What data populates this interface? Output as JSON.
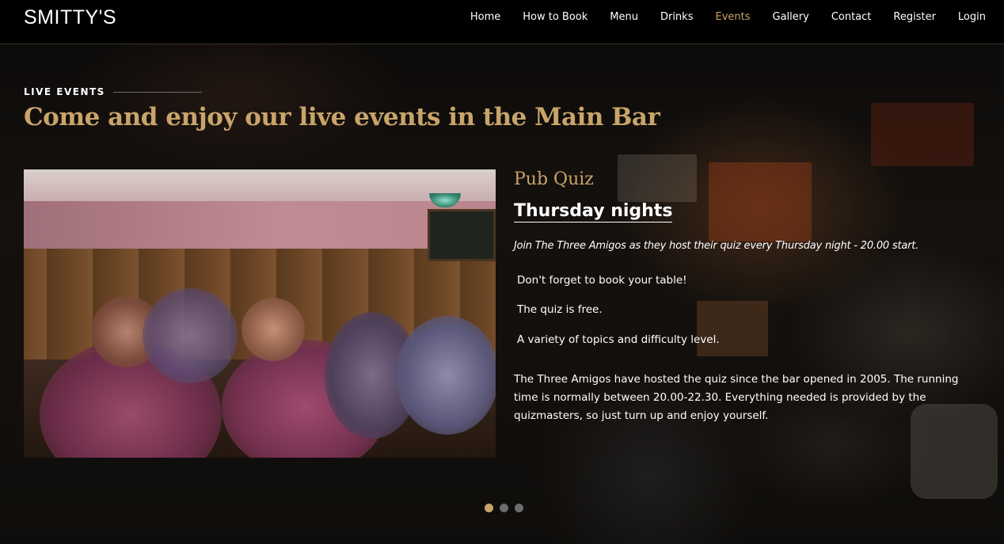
{
  "navbar": {
    "brand": "SMITTY'S",
    "items": [
      {
        "label": "Home",
        "active": false
      },
      {
        "label": "How to Book",
        "active": false
      },
      {
        "label": "Menu",
        "active": false
      },
      {
        "label": "Drinks",
        "active": false
      },
      {
        "label": "Events",
        "active": true
      },
      {
        "label": "Gallery",
        "active": false
      },
      {
        "label": "Contact",
        "active": false
      },
      {
        "label": "Register",
        "active": false
      },
      {
        "label": "Login",
        "active": false
      }
    ]
  },
  "section": {
    "eyebrow": "LIVE EVENTS",
    "headline": "Come and enjoy our live events in the Main Bar"
  },
  "event": {
    "title": "Pub Quiz",
    "when": "Thursday nights",
    "intro": "Join The Three Amigos as they host their quiz every Thursday night - 20.00 start.",
    "points": [
      "Don't forget to book your table!",
      "The quiz is free.",
      "A variety of topics and difficulty level."
    ],
    "description": "The Three Amigos have hosted the quiz since the bar opened in 2005. The running time is normally between 20.00-22.30. Everything needed is provided by the quizmasters, so just turn up and enjoy yourself."
  },
  "carousel": {
    "slide_count": 3,
    "active_index": 0
  },
  "colors": {
    "accent": "#c9a46a",
    "navbar_bg": "#000000",
    "text": "#ffffff"
  }
}
